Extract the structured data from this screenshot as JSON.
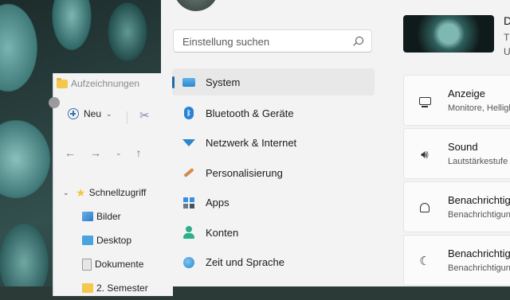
{
  "explorer": {
    "title": "Aufzeichnungen",
    "toolbar": {
      "new_label": "Neu"
    },
    "tree": [
      {
        "label": "Schnellzugriff",
        "icon": "star-icon"
      },
      {
        "label": "Bilder",
        "icon": "pictures-folder-icon"
      },
      {
        "label": "Desktop",
        "icon": "desktop-folder-icon"
      },
      {
        "label": "Dokumente",
        "icon": "documents-folder-icon"
      },
      {
        "label": "2. Semester",
        "icon": "folder-icon"
      }
    ]
  },
  "settings": {
    "search": {
      "placeholder": "Einstellung suchen"
    },
    "nav": [
      {
        "label": "System",
        "icon": "system-icon",
        "active": true
      },
      {
        "label": "Bluetooth & Geräte",
        "icon": "bluetooth-icon"
      },
      {
        "label": "Netzwerk & Internet",
        "icon": "wifi-icon"
      },
      {
        "label": "Personalisierung",
        "icon": "brush-icon"
      },
      {
        "label": "Apps",
        "icon": "apps-icon"
      },
      {
        "label": "Konten",
        "icon": "user-icon"
      },
      {
        "label": "Zeit und Sprache",
        "icon": "clock-globe-icon"
      }
    ],
    "device": {
      "name": "D",
      "line1": "T",
      "line2": "U"
    },
    "cards": [
      {
        "title": "Anzeige",
        "subtitle": "Monitore, Helligk",
        "icon": "monitor-icon"
      },
      {
        "title": "Sound",
        "subtitle": "Lautstärkestufe",
        "icon": "speaker-icon"
      },
      {
        "title": "Benachrichtig",
        "subtitle": "Benachrichtigun",
        "icon": "bell-icon"
      },
      {
        "title": "Benachrichtig",
        "subtitle": "Benachrichtigun",
        "icon": "moon-icon"
      }
    ]
  }
}
